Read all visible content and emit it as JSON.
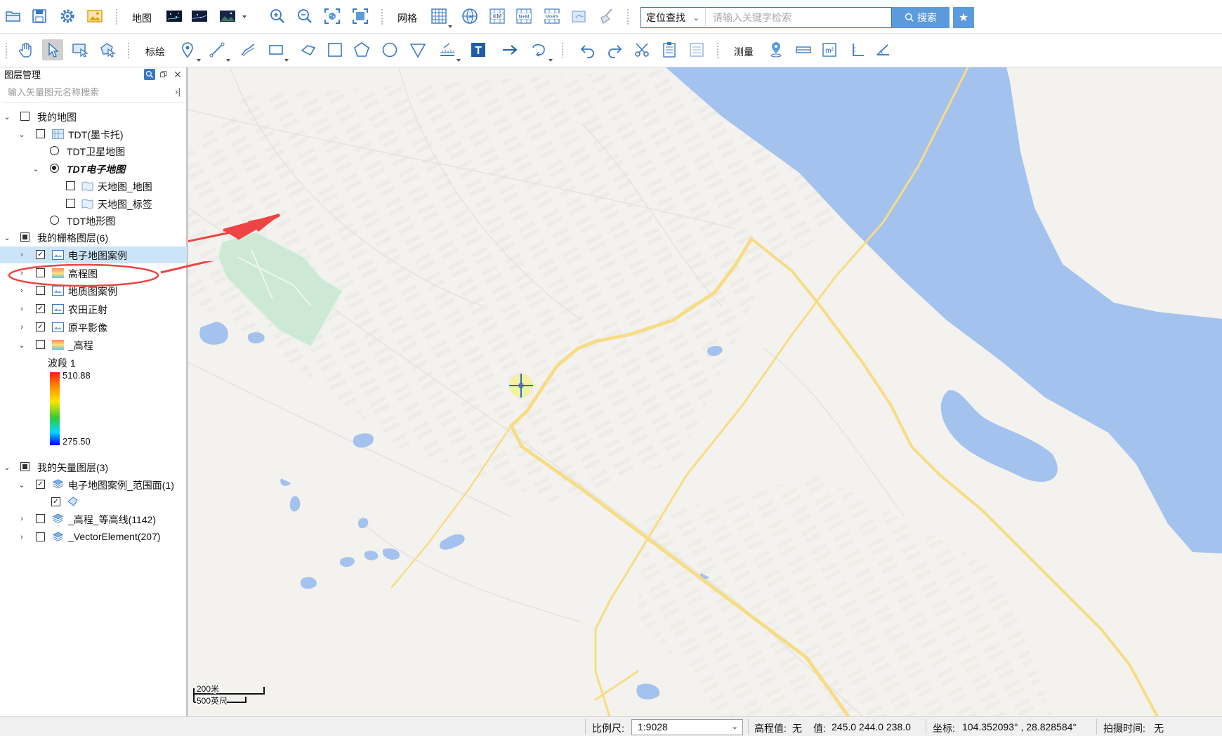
{
  "toolbar1": {
    "map_label": "地图",
    "grid_label": "网格",
    "locate_select": "定位查找",
    "search_placeholder": "请输入关键字检索",
    "search_button": "搜索",
    "grid_tags": {
      "latlon": "Lat",
      "km": "KM",
      "nm": "N+M",
      "mgrs": "MGRS"
    }
  },
  "toolbar2": {
    "draw_label": "标绘",
    "measure_label": "测量",
    "text_tool": "T"
  },
  "panel": {
    "title": "图层管理",
    "search_placeholder": "输入矢量图元名称搜索",
    "tree": {
      "my_map": "我的地图",
      "tdt_mercator": "TDT(墨卡托)",
      "tdt_satellite": "TDT卫星地图",
      "tdt_electronic": "TDT电子地图",
      "tianditu_map": "天地图_地图",
      "tianditu_label": "天地图_标签",
      "tdt_terrain": "TDT地形图",
      "raster_group": "我的栅格图层(6)",
      "raster_items": [
        "电子地图案例",
        "高程图",
        "地质图案例",
        "农田正射",
        "原平影像",
        "_高程"
      ],
      "band_label": "波段 1",
      "legend_max": "510.88",
      "legend_min": "275.50",
      "vector_group": "我的矢量图层(3)",
      "vector_items": [
        "电子地图案例_范围面(1)",
        "_高程_等高线(1142)",
        "_VectorElement(207)"
      ]
    }
  },
  "map": {
    "scale_m": "200米",
    "scale_ft": "500英尺"
  },
  "status": {
    "scale_label": "比例尺:",
    "scale_value": "1:9028",
    "elev_label": "高程值:",
    "elev_value": "无",
    "value_label": "值:",
    "value_value": "245.0 244.0 238.0",
    "coord_label": "坐标:",
    "coord_value": "104.352093° , 28.828584°",
    "time_label": "拍摄时间:",
    "time_value": "无"
  },
  "colors": {
    "accent": "#5b9bdc",
    "water": "#a4c2ee",
    "road": "#f6dd85",
    "park": "#cde8d4",
    "annotation": "#ee4444"
  }
}
